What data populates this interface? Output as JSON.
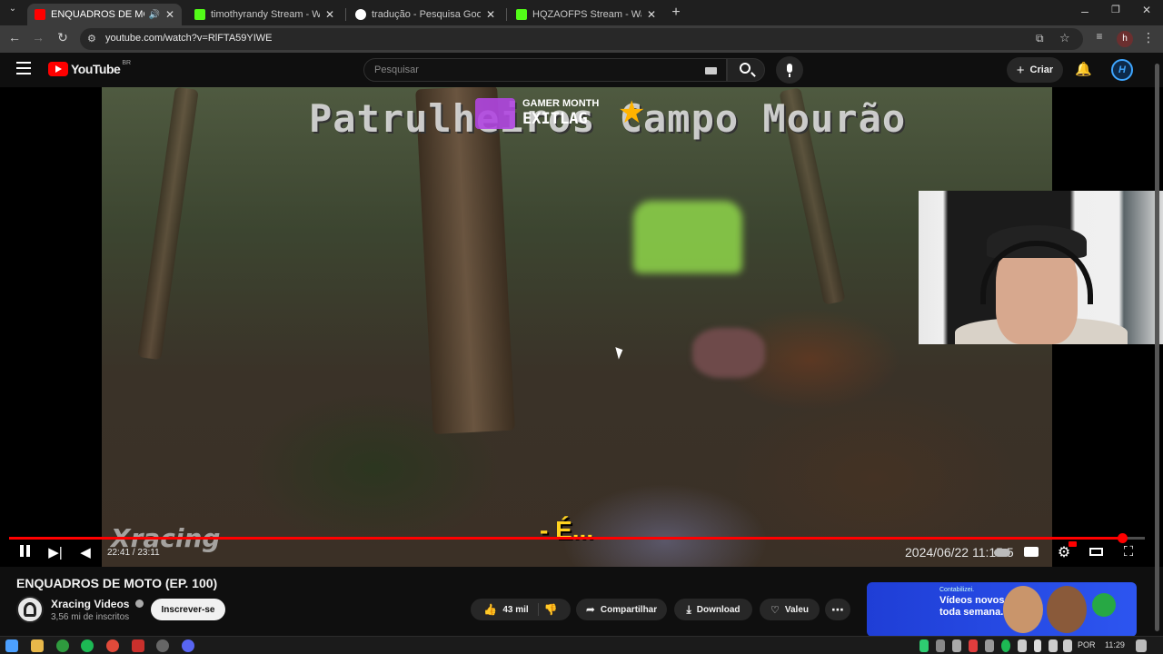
{
  "browser": {
    "tabs": [
      {
        "title": "ENQUADROS DE MOTO (EP",
        "favicon": "youtube-icon",
        "active": true
      },
      {
        "title": "timothyrandy Stream - Watch L",
        "favicon": "kick-icon",
        "active": false
      },
      {
        "title": "tradução - Pesquisa Google",
        "favicon": "google-icon",
        "active": false
      },
      {
        "title": "HQZAOFPS Stream - Watch Live",
        "favicon": "kick-icon",
        "active": false
      }
    ],
    "url": "youtube.com/watch?v=RlFTA59YIWE",
    "profile_initial": "h"
  },
  "masthead": {
    "logo_text": "YouTube",
    "region": "BR",
    "search_placeholder": "Pesquisar",
    "create_label": "Criar"
  },
  "player": {
    "overlay_title": "Patrulheiros Campo Mourão",
    "gamer_month": "GAMER MONTH",
    "exitlag": "EXITLAG",
    "watermark": "Xracing",
    "subtitle": "- É...",
    "datestamp": "2024/06/22 11:15:5",
    "time_current": "22:41",
    "time_total": "23:11",
    "progress": 0.98
  },
  "video": {
    "title": "ENQUADROS DE MOTO (EP. 100)",
    "channel": "Xracing Videos",
    "subscribers": "3,56 mi de inscritos",
    "subscribe_label": "Inscrever-se",
    "likes": "43 mil",
    "share_label": "Compartilhar",
    "download_label": "Download",
    "thanks_label": "Valeu"
  },
  "ad": {
    "brand": "Contabilizei.",
    "line1": "Vídeos novos",
    "line2": "toda semana."
  },
  "taskbar": {
    "lang": "POR",
    "time": "11:29"
  },
  "colors": {
    "youtube_red": "#ff0000",
    "kick_green": "#53fc18",
    "subtitle_yellow": "#ffd21f"
  }
}
